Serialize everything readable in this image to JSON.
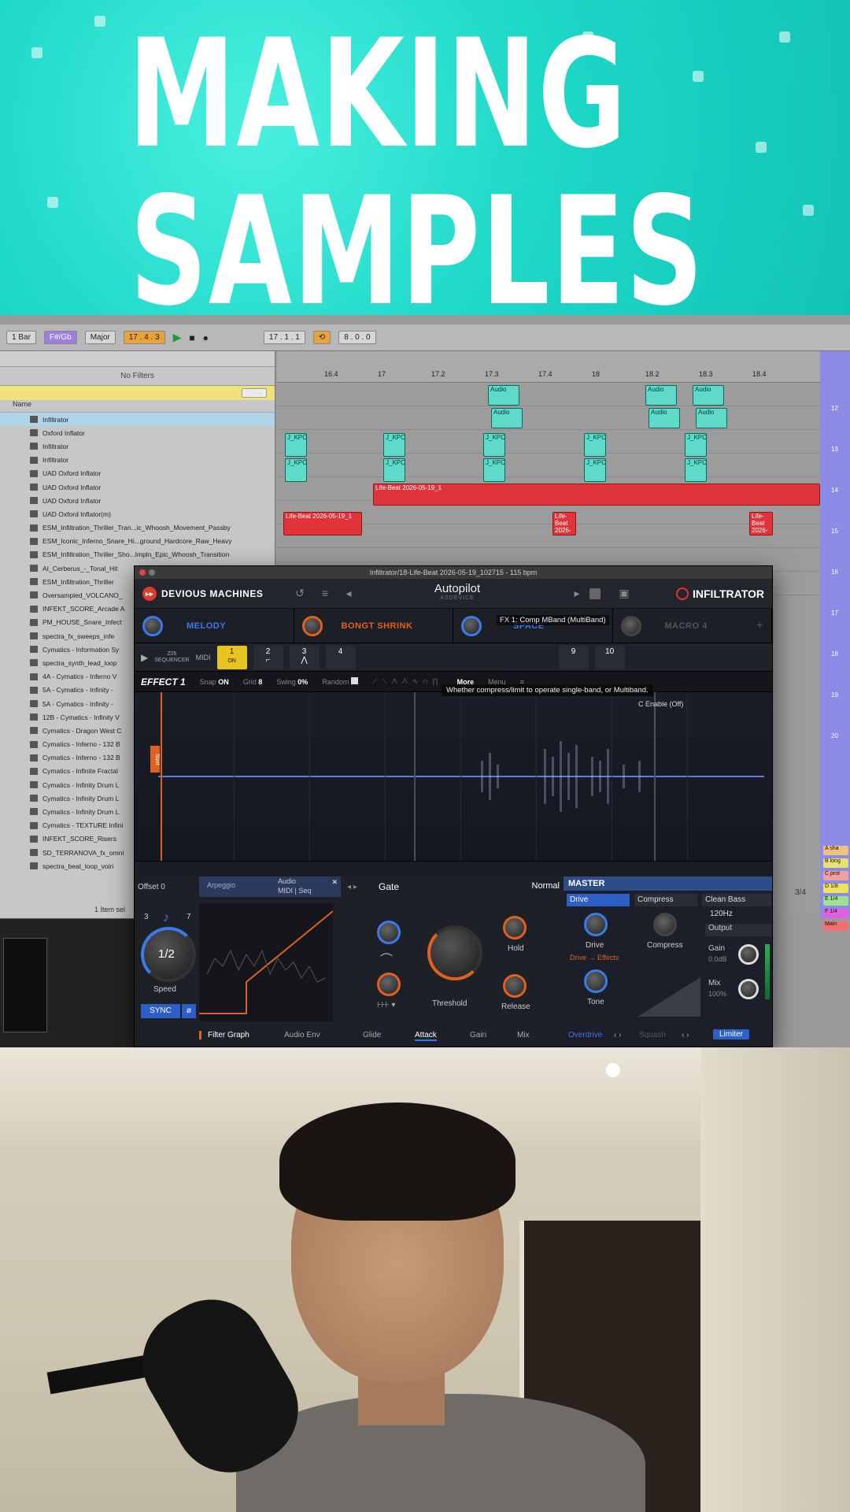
{
  "banner": {
    "title_line1": "MAKING",
    "title_line2": "SAMPLES",
    "background_color": "#1ed8c8"
  },
  "daw": {
    "toolbar": {
      "quantize": "1 Bar",
      "scale": "F#/Gb",
      "mode": "Major",
      "position": "17 . 4 . 3",
      "loop_start": "17 . 1 . 1",
      "loop_length": "8 . 0 . 0"
    },
    "browser": {
      "filters_label": "No Filters",
      "clear_label": "Clear",
      "column_name": "Name",
      "items": [
        "Infiltrator",
        "Oxford Inflator",
        "Infiltrator",
        "Infiltrator",
        "UAD Oxford Inflator",
        "UAD Oxford Inflator",
        "UAD Oxford Inflator",
        "UAD Oxford Inflator(m)",
        "ESM_Infiltration_Thriller_Tran...ic_Whoosh_Movement_Passby",
        "ESM_Iconic_Inferno_Snare_Hi...ground_Hardcore_Raw_Heavy",
        "ESM_Infiltration_Thriller_Sho...Impln_Epic_Whoosh_Transition",
        "AI_Cerberus_-_Tonal_Hit",
        "ESM_Infiltration_Thriller",
        "Oversampled_VOLCANO_",
        "INFEKT_SCORE_Arcade A",
        "PM_HOUSE_Snare_Infect",
        "spectra_fx_sweeps_infe",
        "Cymatics - Information Sy",
        "spectra_synth_lead_loop",
        "4A - Cymatics - Inferno V",
        "5A - Cymatics - Infinity -",
        "5A - Cymatics - Infinity -",
        "12B - Cymatics - Infinity V",
        "Cymatics - Dragon West C",
        "Cymatics - Inferno - 132 B",
        "Cymatics - Inferno - 132 B",
        "Cymatics - Infinite Fractal",
        "Cymatics - Infinity Drum L",
        "Cymatics - Infinity Drum L",
        "Cymatics - Infinity Drum L",
        "Cymatics - TEXTURE Infini",
        "INFEKT_SCORE_Risers",
        "SD_TERRANOVA_fx_omni",
        "spectra_beat_loop_voiri"
      ],
      "footer": "1 Item sel"
    },
    "ruler_ticks": [
      "16.4",
      "17",
      "17.2",
      "17.3",
      "17.4",
      "18",
      "18.2",
      "18.3",
      "18.4"
    ],
    "clips": {
      "audio": "Audio",
      "kpc": "J_KPC",
      "lifebeat": "Life-Beat 2026-05-19_1"
    },
    "right_chips": [
      "A sha",
      "B long",
      "C prot",
      "D 1/8",
      "E 1/4",
      "F 1/4",
      "Main"
    ],
    "right_numbers": [
      "12",
      "13",
      "14",
      "15",
      "16",
      "17",
      "18",
      "19",
      "20"
    ],
    "meter_text": "3/4"
  },
  "plugin": {
    "window_title": "Infiltrator/18-Life-Beat 2026-05-19_102715 - 115 bpm",
    "brand": "DEVIOUS MACHINES",
    "preset_name": "Autopilot",
    "preset_author": "ASDEVICE",
    "product": "INFILTRATOR",
    "macros": [
      {
        "label": "MELODY",
        "color": "#3b7be8"
      },
      {
        "label": "BONGT SHRINK",
        "color": "#e06020"
      },
      {
        "label": "SPACE",
        "color": "#3b7be8"
      },
      {
        "label": "MACRO 4",
        "color": "#555555"
      }
    ],
    "seq": {
      "label_a": "Z05",
      "label_b": "SEQUENCER",
      "midi": "MIDI",
      "slots": [
        "1",
        "2",
        "3",
        "4",
        "9",
        "10"
      ],
      "active_slot_sub": "ON"
    },
    "tooltips": {
      "fx_name": "FX 1: Comp MBand (MultiBand)",
      "description": "Whether compress/limit to operate single-band, or Multiband.",
      "enable": "C Enable (Off)"
    },
    "fx": {
      "name": "EFFECT 1",
      "snap_label": "Snap",
      "snap_value": "ON",
      "grid_label": "Grid",
      "grid_value": "8",
      "swing_label": "Swing",
      "swing_value": "0%",
      "random_label": "Random",
      "more": "More",
      "menu": "Menu",
      "start_marker": "Start"
    },
    "bottom": {
      "offset": "Offset 0",
      "arpeggio": "Arpeggio",
      "route_audio": "Audio",
      "route_midi": "MIDI | Seq",
      "speed_value": "1/2",
      "speed_label": "Speed",
      "speed_min": "3",
      "speed_max": "7",
      "sync": "SYNC",
      "filter_graph": "Filter Graph",
      "audio_env": "Audio Env",
      "gate": "Gate",
      "mode": "Normal",
      "hold": "Hold",
      "threshold": "Threshold",
      "release": "Release",
      "glide": "Glide",
      "attack": "Attack",
      "gain": "Gain",
      "mix": "Mix"
    },
    "master": {
      "title": "MASTER",
      "tab_drive": "Drive",
      "tab_compress": "Compress",
      "tab_clean": "Clean Bass",
      "freq": "120Hz",
      "drive": "Drive",
      "compress": "Compress",
      "output": "Output",
      "route": "Drive → Effects",
      "tone": "Tone",
      "gain": "Gain",
      "gain_value": "0.0dB",
      "mix": "Mix",
      "mix_value": "100%",
      "overdrive": "Overdrive",
      "squash": "Squash",
      "limiter": "Limiter"
    }
  }
}
